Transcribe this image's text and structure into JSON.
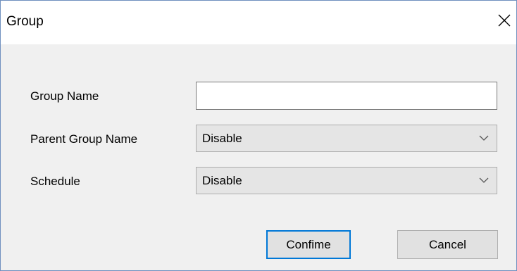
{
  "dialog": {
    "title": "Group",
    "close_icon": "close-icon"
  },
  "form": {
    "group_name": {
      "label": "Group Name",
      "value": ""
    },
    "parent_group": {
      "label": "Parent Group Name",
      "value": "Disable",
      "icon": "chevron-down-icon"
    },
    "schedule": {
      "label": "Schedule",
      "value": "Disable",
      "icon": "chevron-down-icon"
    }
  },
  "buttons": {
    "confirm": "Confime",
    "cancel": "Cancel"
  },
  "colors": {
    "window_border": "#6f8fbf",
    "body_bg": "#f0f0f0",
    "focus_accent": "#0078d7"
  }
}
